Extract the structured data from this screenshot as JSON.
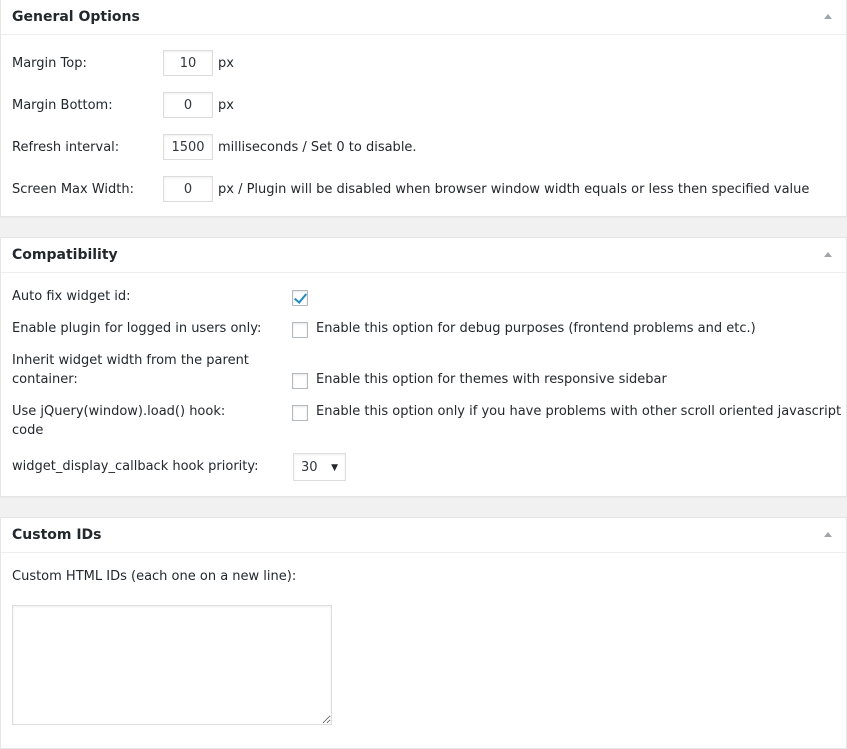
{
  "general": {
    "title": "General Options",
    "margin_top": {
      "label": "Margin Top:",
      "value": "10",
      "unit": "px"
    },
    "margin_bottom": {
      "label": "Margin Bottom:",
      "value": "0",
      "unit": "px"
    },
    "refresh": {
      "label": "Refresh interval:",
      "value": "1500",
      "hint": "milliseconds / Set 0 to disable."
    },
    "screen_max": {
      "label": "Screen Max Width:",
      "value": "0",
      "hint": "px / Plugin will be disabled when browser window width equals or less then specified value"
    }
  },
  "compat": {
    "title": "Compatibility",
    "auto_fix": {
      "label": "Auto fix widget id:",
      "checked": true
    },
    "logged_in": {
      "label": "Enable plugin for logged in users only:",
      "desc": "Enable this option for debug purposes (frontend problems and etc.)",
      "checked": false
    },
    "inherit_width": {
      "label_line1": "Inherit widget width from the parent",
      "label_line2": "container:",
      "desc": "Enable this option for themes with responsive sidebar",
      "checked": false
    },
    "jquery_load": {
      "label_line1": "Use jQuery(window).load() hook:",
      "label_line2": "code",
      "desc": "Enable this option only if you have problems with other scroll oriented javascript",
      "checked": false
    },
    "priority": {
      "label": "widget_display_callback hook priority:",
      "value": "30"
    }
  },
  "custom_ids": {
    "title": "Custom IDs",
    "label": "Custom HTML IDs (each one on a new line):",
    "value": ""
  },
  "colors": {
    "page_bg": "#f1f1f1",
    "panel_bg": "#ffffff",
    "check": "#1e8cbe"
  }
}
